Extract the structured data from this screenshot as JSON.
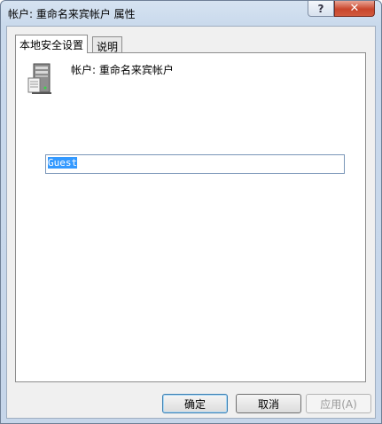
{
  "window": {
    "title": "帐户: 重命名来宾帐户 属性"
  },
  "titlebar": {
    "help_label": "?",
    "close_label": "✕"
  },
  "tabs": [
    {
      "label": "本地安全设置",
      "active": true
    },
    {
      "label": "说明",
      "active": false
    }
  ],
  "panel": {
    "icon": "server-icon",
    "account_label": "帐户: 重命名来宾帐户",
    "input_value": "Guest"
  },
  "buttons": {
    "ok": "确定",
    "cancel": "取消",
    "apply": "应用(A)"
  }
}
